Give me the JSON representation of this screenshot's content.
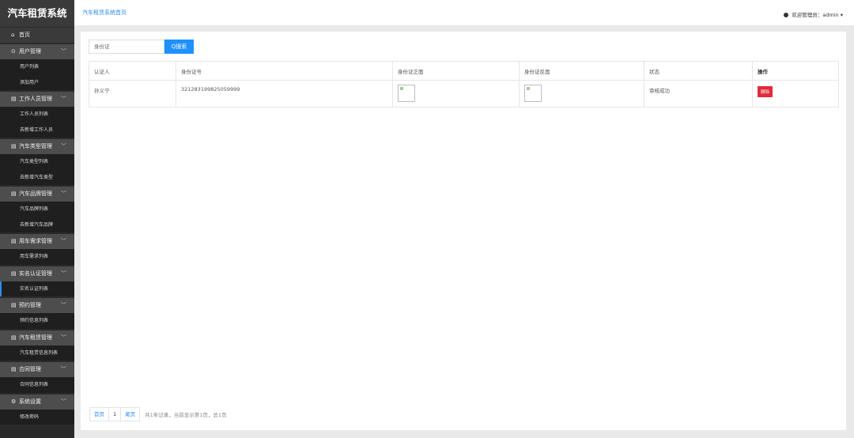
{
  "app": {
    "title": "汽车租赁系统"
  },
  "sidebar": {
    "home": "首页",
    "groups": [
      {
        "label": "用户管理",
        "items": [
          "用户列表",
          "添加用户"
        ]
      },
      {
        "label": "工作人员管理",
        "items": [
          "工作人员列表",
          "去新增工作人员"
        ]
      },
      {
        "label": "汽车类型管理",
        "items": [
          "汽车类型列表",
          "去新增汽车类型"
        ]
      },
      {
        "label": "汽车品牌管理",
        "items": [
          "汽车品牌列表",
          "去新增汽车品牌"
        ]
      },
      {
        "label": "用车需求管理",
        "items": [
          "用车需求列表"
        ]
      },
      {
        "label": "实名认证管理",
        "items": [
          "实名认证列表"
        ]
      },
      {
        "label": "预约管理",
        "items": [
          "预约信息列表"
        ]
      },
      {
        "label": "汽车租赁管理",
        "items": [
          "汽车租赁信息列表"
        ]
      },
      {
        "label": "合同管理",
        "items": [
          "合同信息列表"
        ]
      },
      {
        "label": "系统设置",
        "items": [
          "修改密码"
        ]
      }
    ]
  },
  "topbar": {
    "breadcrumb": "汽车租赁系统首页",
    "user": "欢迎管理员：admin"
  },
  "search": {
    "placeholder": "身份证",
    "button": "Q搜索"
  },
  "table": {
    "headers": [
      "认证人",
      "身份证号",
      "身份证正面",
      "身份证反面",
      "状态",
      "操作"
    ],
    "rows": [
      {
        "name": "孙义宁",
        "id_number": "321283199825059999",
        "status": "审核成功",
        "action": "删除"
      }
    ]
  },
  "pagination": {
    "first": "首页",
    "page": "1",
    "last": "尾页",
    "info": "共1条记录，当前显示第1页，总1页"
  }
}
